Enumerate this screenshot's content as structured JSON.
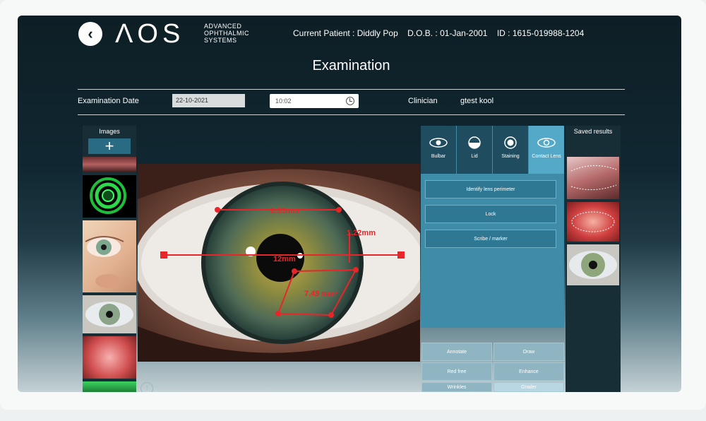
{
  "header": {
    "logo": "ΛOS",
    "logo_sub": [
      "ADVANCED",
      "OPHTHALMIC",
      "SYSTEMS"
    ],
    "patient_label": "Current Patient : Diddly Pop",
    "dob": "D.O.B. : 01-Jan-2001",
    "id": "ID : 1615-019988-1204",
    "back_icon": "chevron-left-icon"
  },
  "page_title": "Examination",
  "exam": {
    "date_label": "Examination Date",
    "date_value": "22-10-2021",
    "time_value": "10:02",
    "clinician_label": "Clinician",
    "clinician_value": "gtest kool"
  },
  "images": {
    "title": "Images",
    "add_label": "+"
  },
  "measurements": {
    "horizontal": "12mm",
    "top": "8.55mm",
    "right": "1.22mm",
    "area": "7.49 mm²"
  },
  "modes": [
    {
      "label": "Bulbar",
      "icon": "eye-icon"
    },
    {
      "label": "Lid",
      "icon": "half-circle-icon"
    },
    {
      "label": "Staining",
      "icon": "target-icon"
    },
    {
      "label": "Contact Lens",
      "icon": "contact-lens-icon"
    }
  ],
  "tools": [
    {
      "label": "Identify lens perimeter"
    },
    {
      "label": "Lock"
    },
    {
      "label": "Scribe / marker"
    }
  ],
  "bottom_tools": [
    {
      "label": "Annotate"
    },
    {
      "label": "Draw"
    },
    {
      "label": "Red free"
    },
    {
      "label": "Enhance"
    },
    {
      "label": "Wrinkles"
    },
    {
      "label": "Grader"
    }
  ],
  "saved": {
    "title": "Saved results"
  },
  "colors": {
    "accent": "#3e8ca7",
    "active_mode": "#54a9c8",
    "annotation": "#e8262a"
  }
}
